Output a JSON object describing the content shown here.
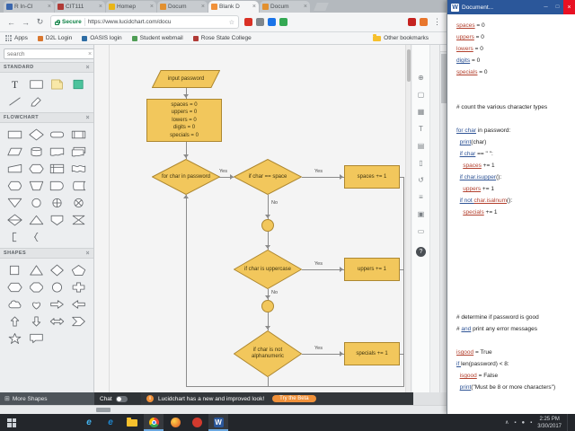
{
  "browser": {
    "tabs": [
      {
        "label": "R In-Cl",
        "favicon_color": "#3a66ad",
        "active": false
      },
      {
        "label": "CIT111",
        "favicon_color": "#b03a36",
        "active": false
      },
      {
        "label": "Homep",
        "favicon_color": "#e9b517",
        "active": false
      },
      {
        "label": "Docum",
        "favicon_color": "#e2902f",
        "active": false
      },
      {
        "label": "Blank D",
        "favicon_color": "#f0913a",
        "active": true
      },
      {
        "label": "Docum",
        "favicon_color": "#e2902f",
        "active": false
      }
    ],
    "address_bar": {
      "secure_label": "Secure",
      "url": "https://www.lucidchart.com/docu"
    },
    "bookmarks_bar": {
      "apps_label": "Apps",
      "items": [
        {
          "label": "D2L Login",
          "icon_color": "#d9772f"
        },
        {
          "label": "OASIS login",
          "icon_color": "#2e6da4"
        },
        {
          "label": "Student webmail",
          "icon_color": "#4f9d55"
        },
        {
          "label": "Rose State College",
          "icon_color": "#b03a36"
        }
      ],
      "other_bookmarks_label": "Other bookmarks"
    }
  },
  "lucidchart": {
    "search_placeholder": "search",
    "libraries": [
      {
        "title": "STANDARD",
        "shapes": [
          "text",
          "rectangle",
          "note",
          "block",
          "line",
          "pen"
        ]
      },
      {
        "title": "FLOWCHART",
        "shapes": [
          "process",
          "decision",
          "terminator",
          "predefined-process",
          "data",
          "database",
          "document",
          "multi-document",
          "manual-input",
          "preparation",
          "internal-storage",
          "paper-tape",
          "display",
          "manual-operation",
          "delay",
          "stored-data",
          "merge",
          "connector",
          "or-junction",
          "summing-junction",
          "sort",
          "extract",
          "off-page-connector",
          "collate",
          "bracket",
          "brace"
        ]
      },
      {
        "title": "SHAPES",
        "shapes": [
          "square",
          "triangle",
          "diamond",
          "pentagon",
          "hexagon",
          "octagon",
          "circle",
          "cross",
          "cloud",
          "heart",
          "arrow-right",
          "arrow-left",
          "arrow-up",
          "arrow-down",
          "double-arrow",
          "chevron",
          "star",
          "callout"
        ]
      }
    ],
    "toolbar_icons": [
      "pan",
      "zoom",
      "grid",
      "text",
      "sticky-note",
      "page",
      "revision-history",
      "layers",
      "shape-library",
      "comments"
    ],
    "help_label": "?",
    "bottom_bar": {
      "more_shapes_label": "More Shapes",
      "chat_label": "Chat",
      "banner_text": "Lucidchart has a new and improved look!",
      "banner_button": "Try the Beta",
      "banner_accent": "#f0913a"
    }
  },
  "flowchart": {
    "yes_label": "Yes",
    "no_label": "No",
    "shape_fill": "#f2c75c",
    "shape_border": "#ad8730",
    "nodes": {
      "input": "input password",
      "init": [
        "spaces = 0",
        "uppers = 0",
        "lowers = 0",
        "digits = 0",
        "specials = 0"
      ],
      "loop": "for char in password",
      "if_space": "if char == space",
      "add_space": "spaces += 1",
      "if_upper": "if char is uppercase",
      "add_upper": "uppers += 1",
      "if_alnum": "if char is not alphanumeric",
      "add_special": "specials += 1"
    }
  },
  "word": {
    "window_title": "Document...",
    "app_icon_letter": "W",
    "code_lines": [
      [
        {
          "t": "spaces",
          "f": "r"
        },
        {
          "t": " = 0"
        }
      ],
      [
        {
          "t": "uppers",
          "f": "r"
        },
        {
          "t": " = 0"
        }
      ],
      [
        {
          "t": "lowers",
          "f": "r"
        },
        {
          "t": " = 0"
        }
      ],
      [
        {
          "t": "digits",
          "f": "b"
        },
        {
          "t": " = 0"
        }
      ],
      [
        {
          "t": "specials",
          "f": "r"
        },
        {
          "t": " = 0"
        }
      ],
      [],
      [],
      [
        {
          "t": "# count the various character types"
        }
      ],
      [],
      [
        {
          "t": "for char",
          "f": "b"
        },
        {
          "t": " in password:"
        }
      ],
      [
        {
          "t": "  "
        },
        {
          "t": "print",
          "f": "b"
        },
        {
          "t": "(char)"
        }
      ],
      [
        {
          "t": "  "
        },
        {
          "t": "if char",
          "f": "b"
        },
        {
          "t": " == \" \":"
        }
      ],
      [
        {
          "t": "    "
        },
        {
          "t": "spaces",
          "f": "r"
        },
        {
          "t": " += 1"
        }
      ],
      [
        {
          "t": "  "
        },
        {
          "t": "if char.isupper",
          "f": "b"
        },
        {
          "t": "():"
        }
      ],
      [
        {
          "t": "    "
        },
        {
          "t": "uppers",
          "f": "r"
        },
        {
          "t": " += 1"
        }
      ],
      [
        {
          "t": "  "
        },
        {
          "t": "if not ",
          "f": "b"
        },
        {
          "t": "char.isalnum",
          "f": "r"
        },
        {
          "t": "():"
        }
      ],
      [
        {
          "t": "    "
        },
        {
          "t": "specials",
          "f": "r"
        },
        {
          "t": " += 1"
        }
      ],
      [],
      [],
      [],
      [],
      [],
      [],
      [],
      [],
      [
        {
          "t": "# determine if password is good"
        }
      ],
      [
        {
          "t": "# "
        },
        {
          "t": "and",
          "f": "b"
        },
        {
          "t": " print any error messages"
        }
      ],
      [],
      [
        {
          "t": "isgood",
          "f": "r"
        },
        {
          "t": " = True"
        }
      ],
      [
        {
          "t": "if ",
          "f": "b"
        },
        {
          "t": "len(password)"
        },
        {
          "t": " < 8:"
        }
      ],
      [
        {
          "t": "  "
        },
        {
          "t": "isgood",
          "f": "r"
        },
        {
          "t": " = False"
        }
      ],
      [
        {
          "t": "  "
        },
        {
          "t": "print",
          "f": "b"
        },
        {
          "t": "(\"Must be 8 or more characters\")"
        }
      ]
    ]
  },
  "taskbar": {
    "apps": [
      "internet-explorer",
      "edge",
      "file-explorer",
      "chrome",
      "firefox",
      "opera",
      "word"
    ],
    "clock_time": "2:25 PM",
    "clock_date": "3/30/2017"
  }
}
